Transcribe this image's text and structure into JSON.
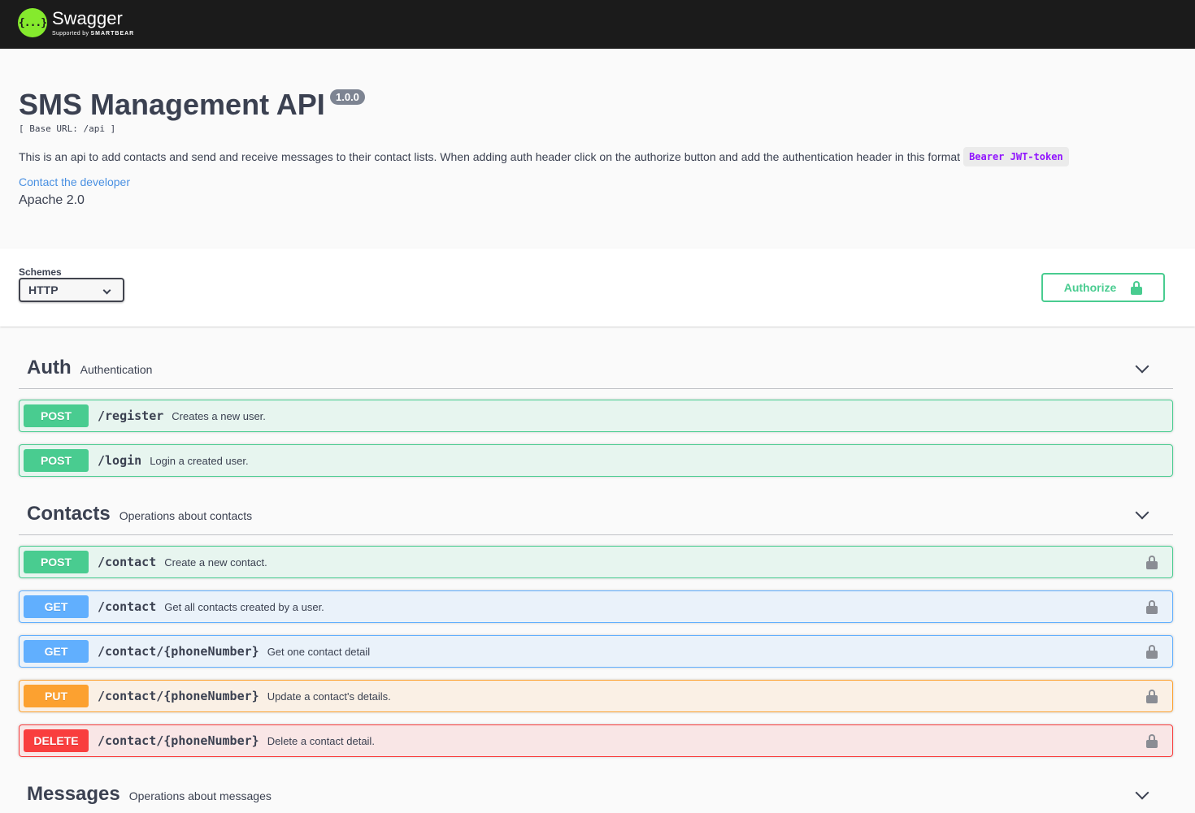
{
  "topbar": {
    "logo_glyph": "{...}",
    "logo_name": "Swagger",
    "logo_sub_prefix": "Supported by",
    "logo_sub_brand": "SMARTBEAR"
  },
  "info": {
    "title": "SMS Management API",
    "version": "1.0.0",
    "base_url": "[ Base URL: /api ]",
    "description": "This is an api to add contacts and send and receive messages to their contact lists. When adding auth header click on the authorize button and add the authentication header in this format",
    "description_code": "Bearer JWT-token",
    "contact_link": "Contact the developer",
    "license": "Apache 2.0"
  },
  "schemes": {
    "label": "Schemes",
    "selected": "HTTP",
    "authorize_label": "Authorize"
  },
  "tags": [
    {
      "name": "Auth",
      "description": "Authentication",
      "operations": [
        {
          "method": "POST",
          "path": "/register",
          "summary": "Creates a new user.",
          "locked": false
        },
        {
          "method": "POST",
          "path": "/login",
          "summary": "Login a created user.",
          "locked": false
        }
      ]
    },
    {
      "name": "Contacts",
      "description": "Operations about contacts",
      "operations": [
        {
          "method": "POST",
          "path": "/contact",
          "summary": "Create a new contact.",
          "locked": true
        },
        {
          "method": "GET",
          "path": "/contact",
          "summary": "Get all contacts created by a user.",
          "locked": true
        },
        {
          "method": "GET",
          "path": "/contact/{phoneNumber}",
          "summary": "Get one contact detail",
          "locked": true
        },
        {
          "method": "PUT",
          "path": "/contact/{phoneNumber}",
          "summary": "Update a contact's details.",
          "locked": true
        },
        {
          "method": "DELETE",
          "path": "/contact/{phoneNumber}",
          "summary": "Delete a contact detail.",
          "locked": true
        }
      ]
    },
    {
      "name": "Messages",
      "description": "Operations about messages",
      "operations": []
    }
  ],
  "colors": {
    "post": "#49cc90",
    "get": "#61affe",
    "put": "#fca130",
    "delete": "#f93e3e",
    "topbar": "#1b1b1b",
    "logo": "#85ea2d"
  }
}
